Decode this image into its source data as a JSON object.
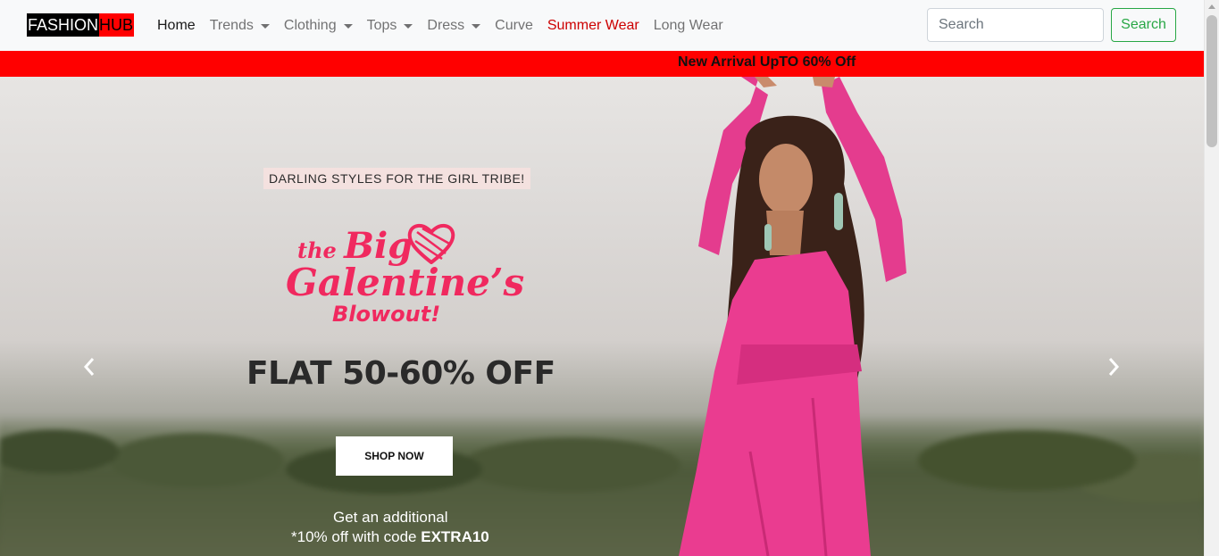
{
  "navbar": {
    "brand_part1": "FASHION",
    "brand_part2": "HUB",
    "items": [
      {
        "label": "Home",
        "dropdown": false
      },
      {
        "label": "Trends",
        "dropdown": true
      },
      {
        "label": "Clothing",
        "dropdown": true
      },
      {
        "label": "Tops",
        "dropdown": true
      },
      {
        "label": "Dress",
        "dropdown": true
      },
      {
        "label": "Curve",
        "dropdown": false
      },
      {
        "label": "Summer Wear",
        "dropdown": false
      },
      {
        "label": "Long Wear",
        "dropdown": false
      }
    ],
    "search_placeholder": "Search",
    "search_button": "Search"
  },
  "promo": {
    "text": "New Arrival UpTO 60% Off"
  },
  "banner": {
    "tagline": "DARLING STYLES FOR THE GIRL TRIBE!",
    "title_small": "the ",
    "title_big": "Big",
    "title_line2": "Galentine’s",
    "title_line3": "Blowout!",
    "offer": "FLAT 50-60% OFF",
    "cta": "SHOP NOW",
    "extra_line1": "Get an additional",
    "extra_line2_prefix": "*10% off with code ",
    "extra_code": "EXTRA10"
  },
  "colors": {
    "brand_black": "#000000",
    "brand_red": "#ff0000",
    "promo_bg": "#ff0000",
    "banner_pink": "#f0295f",
    "search_green": "#28a745",
    "summer_wear_red": "#cc0000"
  },
  "icons": {
    "prev": "chevron-left-icon",
    "next": "chevron-right-icon",
    "heart": "heart-icon"
  }
}
